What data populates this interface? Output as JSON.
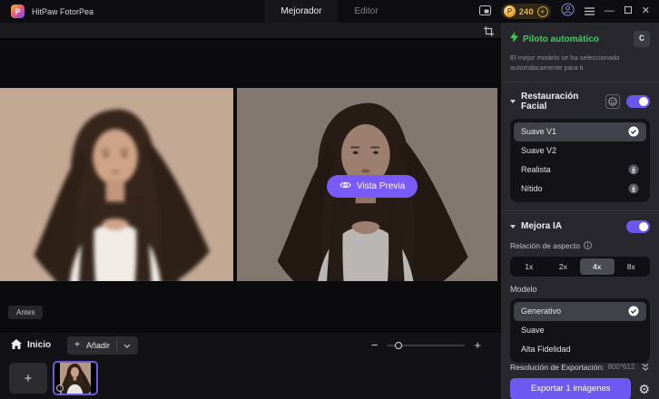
{
  "titlebar": {
    "app_name": "HitPaw FotorPea",
    "tabs": [
      {
        "label": "Mejorador",
        "active": true
      },
      {
        "label": "Editor",
        "active": false
      }
    ],
    "credits": "240"
  },
  "canvas": {
    "preview_button": "Vista Previa",
    "before_label": "Antes"
  },
  "sidebar": {
    "autopilot": {
      "title": "Piloto automático",
      "description": "El mejor modelo se ha seleccionado automáticamente para ti."
    },
    "face_restore": {
      "title": "Restauración Facial",
      "items": [
        {
          "label": "Suave V1",
          "state": "selected"
        },
        {
          "label": "Suave V2",
          "state": "none"
        },
        {
          "label": "Realista",
          "state": "download"
        },
        {
          "label": "Nítido",
          "state": "download"
        }
      ]
    },
    "ai_enhance": {
      "title": "Mejora IA",
      "aspect_label": "Relación de aspecto",
      "scales": [
        {
          "label": "1x",
          "active": false
        },
        {
          "label": "2x",
          "active": false
        },
        {
          "label": "4x",
          "active": true
        },
        {
          "label": "8x",
          "active": false
        }
      ],
      "model_label": "Modelo",
      "models": [
        {
          "label": "Generativo",
          "state": "selected"
        },
        {
          "label": "Suave",
          "state": "none"
        },
        {
          "label": "Alta Fidelidad",
          "state": "none"
        }
      ]
    },
    "export": {
      "resolution_label": "Resolución de Exportación:",
      "resolution_value": "800*612",
      "button_label": "Exportar 1 imágenes"
    }
  },
  "bottombar": {
    "home_label": "Inicio",
    "add_label": "Añadir"
  },
  "colors": {
    "accent_purple": "#7a5af8",
    "accent_green": "#35d157",
    "gold": "#e9b94c"
  }
}
